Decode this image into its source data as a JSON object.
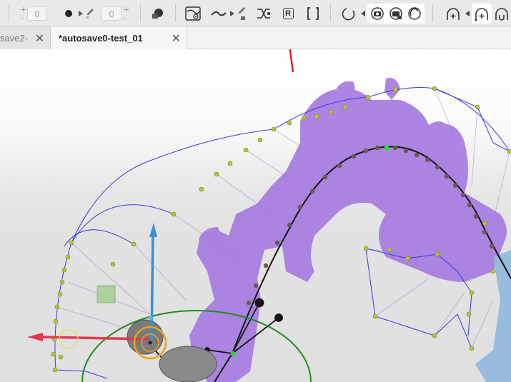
{
  "toolbar": {
    "field_a_value": "0",
    "field_b_value": "0",
    "plus_glyph": "+",
    "minus_glyph": "-",
    "r_button_label": "R"
  },
  "tabs": [
    {
      "label": "save2-",
      "close": "✕"
    },
    {
      "label": "*autosave0-test_01",
      "close": "✕"
    }
  ],
  "viewport": {
    "accent_colors": {
      "motion_trail": "#7a4bd0",
      "pose_silhouette": "#a67be0",
      "spline_wire": "#3a3ae0",
      "control_point": "#b7c43a",
      "gizmo_x": "#e2384d",
      "gizmo_y_ring": "#e9a21c",
      "gizmo_z": "#3a8fd6",
      "ground_circle": "#1f8a1f",
      "annotation_arrow": "#e82020"
    }
  }
}
